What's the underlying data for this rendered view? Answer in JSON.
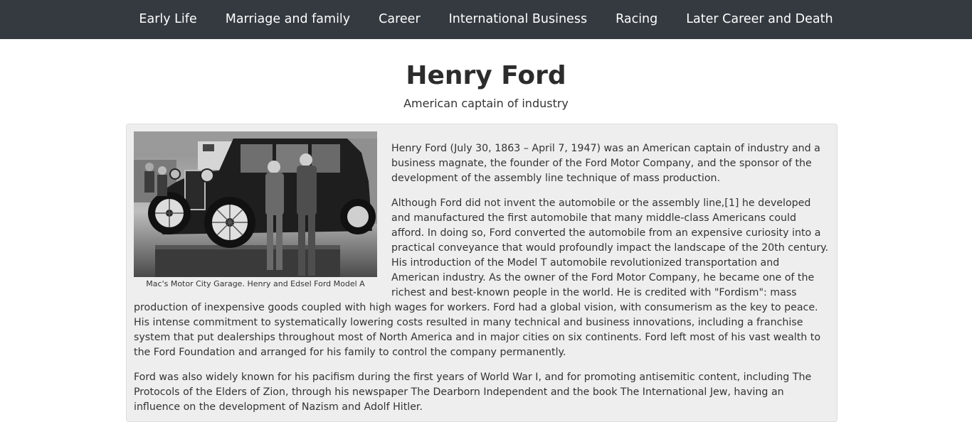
{
  "nav": {
    "items": [
      {
        "label": "Early Life"
      },
      {
        "label": "Marriage and family"
      },
      {
        "label": "Career"
      },
      {
        "label": "International Business"
      },
      {
        "label": "Racing"
      },
      {
        "label": "Later Career and Death"
      }
    ]
  },
  "header": {
    "title": "Henry Ford",
    "subtitle": "American captain of industry"
  },
  "bio": {
    "image_caption": "Mac's Motor City Garage. Henry and Edsel Ford Model A",
    "paragraphs": [
      "Henry Ford (July 30, 1863 – April 7, 1947) was an American captain of industry and a business magnate, the founder of the Ford Motor Company, and the sponsor of the development of the assembly line technique of mass production.",
      "Although Ford did not invent the automobile or the assembly line,[1] he developed and manufactured the first automobile that many middle-class Americans could afford. In doing so, Ford converted the automobile from an expensive curiosity into a practical conveyance that would profoundly impact the landscape of the 20th century. His introduction of the Model T automobile revolutionized transportation and American industry. As the owner of the Ford Motor Company, he became one of the richest and best-known people in the world. He is credited with \"Fordism\": mass production of inexpensive goods coupled with high wages for workers. Ford had a global vision, with consumerism as the key to peace. His intense commitment to systematically lowering costs resulted in many technical and business innovations, including a franchise system that put dealerships throughout most of North America and in major cities on six continents. Ford left most of his vast wealth to the Ford Foundation and arranged for his family to control the company permanently.",
      "Ford was also widely known for his pacifism during the first years of World War I, and for promoting antisemitic content, including The Protocols of the Elders of Zion, through his newspaper The Dearborn Independent and the book The International Jew, having an influence on the development of Nazism and Adolf Hitler."
    ]
  }
}
